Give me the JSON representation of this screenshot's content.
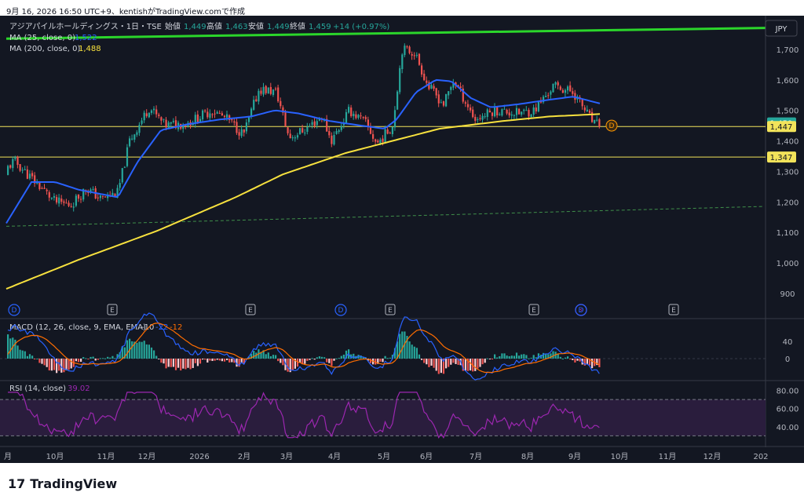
{
  "header": {
    "note": "9月 16, 2026 16:50 UTC+9、kentishがTradingView.comで作成"
  },
  "branding": {
    "logo_mark": "17",
    "logo_text": "TradingView"
  },
  "legend": {
    "title": "アジアパイルホールディングス・1日・TSE",
    "ohlc": [
      {
        "label": "始値",
        "value": "1,449"
      },
      {
        "label": "高値",
        "value": "1,463"
      },
      {
        "label": "安値",
        "value": "1,449"
      },
      {
        "label": "終値",
        "value": "1,459"
      }
    ],
    "change": "+14 (+0.97%)",
    "ma25_label": "MA (25, close, 0)",
    "ma25_value": "1,522",
    "ma200_label": "MA (200, close, 0)",
    "ma200_value": "1,488"
  },
  "currency": "JPY",
  "colors": {
    "background": "#131722",
    "up": "#26a69a",
    "down": "#ef5350",
    "ma25": "#2962ff",
    "ma200": "#f7e13e",
    "trend": "#2bd62b",
    "hline": "#f2e35a",
    "rsi": "#9c27b0",
    "macd": "#2962ff",
    "signal": "#ff6d00",
    "last_price_bg": "#26a69a"
  },
  "chart_data": {
    "type": "candlestick",
    "main": {
      "y_ticks": [
        "1,700",
        "1,600",
        "1,500",
        "1,400",
        "1,300",
        "1,200",
        "1,100",
        "1,000",
        "900"
      ],
      "y_tick_values": [
        1700,
        1600,
        1500,
        1400,
        1300,
        1200,
        1100,
        1000,
        900
      ],
      "ylim": [
        820,
        1800
      ],
      "price_labels": [
        {
          "text": "1,459",
          "value": 1459,
          "kind": "last"
        },
        {
          "text": "1,447",
          "value": 1447,
          "kind": "line"
        },
        {
          "text": "1,347",
          "value": 1347,
          "kind": "line"
        }
      ],
      "horizontal_lines": [
        1447,
        1347
      ],
      "trend_line": {
        "from": 1735,
        "to": 1770
      },
      "dashed_line": {
        "from": 1120,
        "to": 1185
      },
      "events": [
        {
          "type": "D",
          "month_index": 0
        },
        {
          "type": "E",
          "month_index": 2
        },
        {
          "type": "E",
          "month_index": 5
        },
        {
          "type": "D",
          "month_index": 7
        },
        {
          "type": "E",
          "month_index": 8
        },
        {
          "type": "E",
          "month_index": 11
        },
        {
          "type": "S",
          "month_index": 12
        },
        {
          "type": "D",
          "month_index": 12
        },
        {
          "type": "E",
          "month_index": 14
        }
      ],
      "event_label_near_price": "D"
    },
    "x_ticks": [
      "月",
      "10月",
      "11月",
      "12月",
      "2026",
      "2月",
      "3月",
      "4月",
      "5月",
      "6月",
      "7月",
      "8月",
      "9月",
      "10月",
      "11月",
      "12月",
      "202"
    ],
    "series": [
      {
        "name": "MA (25, close, 0)",
        "key": "ma25"
      },
      {
        "name": "MA (200, close, 0)",
        "key": "ma200"
      }
    ],
    "macd": {
      "label": "MACD (12, 26, close, 9, EMA, EMA)",
      "values": [
        "-10",
        "-22",
        "-12"
      ],
      "y_ticks": [
        "40",
        "0"
      ],
      "y_tick_values": [
        40,
        0
      ]
    },
    "rsi": {
      "label": "RSI (14, close)",
      "value": "39.02",
      "y_ticks": [
        "80.00",
        "60.00",
        "40.00"
      ],
      "y_tick_values": [
        80,
        60,
        40
      ],
      "band": [
        30,
        70
      ]
    }
  }
}
